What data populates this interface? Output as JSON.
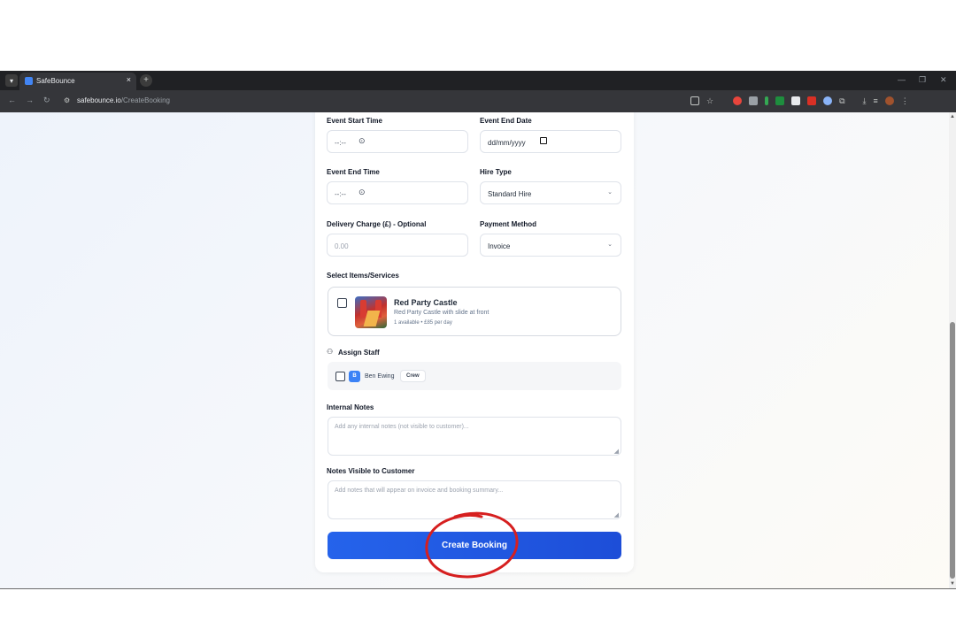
{
  "browser": {
    "tab_title": "SafeBounce",
    "tab_close": "×",
    "new_tab": "+",
    "url_domain": "safebounce.io",
    "url_path": "/CreateBooking",
    "window_minimize": "—",
    "window_restore": "❐",
    "window_close": "✕"
  },
  "form": {
    "event_start_time": {
      "label": "Event Start Time",
      "value": "--:--"
    },
    "event_end_date": {
      "label": "Event End Date",
      "value": "dd/mm/yyyy"
    },
    "event_end_time": {
      "label": "Event End Time",
      "value": "--:--"
    },
    "hire_type": {
      "label": "Hire Type",
      "value": "Standard Hire"
    },
    "delivery_charge": {
      "label": "Delivery Charge (£) - Optional",
      "placeholder": "0.00"
    },
    "payment_method": {
      "label": "Payment Method",
      "value": "Invoice"
    },
    "items_label": "Select Items/Services",
    "items": [
      {
        "name": "Red Party Castle",
        "description": "Red Party Castle with slide at front",
        "meta": "1 available • £85 per day",
        "checked": false
      }
    ],
    "assign_staff_label": "Assign Staff",
    "staff": [
      {
        "initial": "B",
        "name": "Ben Ewing",
        "role": "Crew",
        "checked": false
      }
    ],
    "internal_notes": {
      "label": "Internal Notes",
      "placeholder": "Add any internal notes (not visible to customer)..."
    },
    "customer_notes": {
      "label": "Notes Visible to Customer",
      "placeholder": "Add notes that will appear on invoice and booking summary..."
    },
    "submit_label": "Create Booking"
  },
  "colors": {
    "primary": "#2563eb",
    "annotation": "#d61f1f",
    "avatar": "#3b82f6"
  }
}
